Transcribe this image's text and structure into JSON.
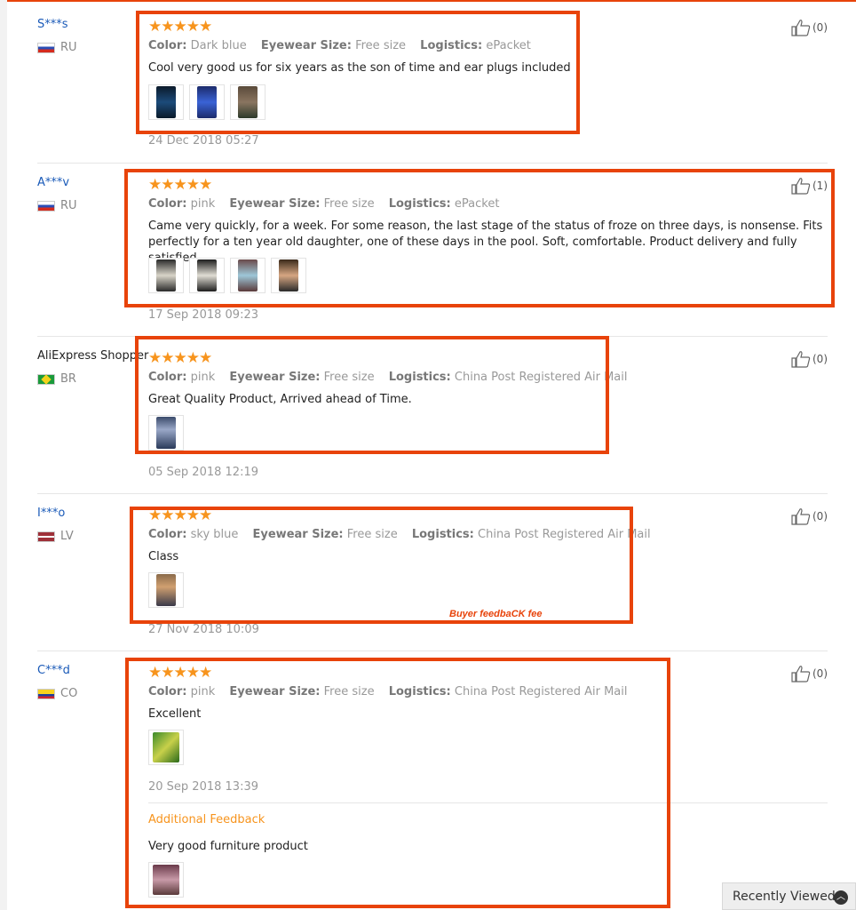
{
  "colors": {
    "accent": "#e8430a",
    "star": "#f7941d",
    "link": "#1a5ab8"
  },
  "labels": {
    "color": "Color:",
    "size": "Eyewear Size:",
    "logistics": "Logistics:",
    "stars": "★★★★★"
  },
  "reviews": [
    {
      "user": "S***s",
      "country": "RU",
      "color": "Dark blue",
      "size": "Free size",
      "logistics": "ePacket",
      "text": "Cool very good us for six years as the son of time and ear plugs included",
      "date": "24 Dec 2018 05:27",
      "helpful": "(0)"
    },
    {
      "user": "A***v",
      "country": "RU",
      "color": "pink",
      "size": "Free size",
      "logistics": "ePacket",
      "text": "Came very quickly, for a week. For some reason, the last stage of the status of froze on three days, is nonsense. Fits perfectly for a ten year old daughter, one of these days in the pool. Soft, comfortable. Product delivery and fully satisfied.",
      "date": "17 Sep 2018 09:23",
      "helpful": "(1)"
    },
    {
      "user": "AliExpress Shopper",
      "country": "BR",
      "color": "pink",
      "size": "Free size",
      "logistics": "China Post Registered Air Mail",
      "text": "Great Quality Product, Arrived ahead of Time.",
      "date": "05 Sep 2018 12:19",
      "helpful": "(0)"
    },
    {
      "user": "I***o",
      "country": "LV",
      "color": "sky blue",
      "size": "Free size",
      "logistics": "China Post Registered Air Mail",
      "text": "Class",
      "date": "27 Nov 2018 10:09",
      "helpful": "(0)"
    },
    {
      "user": "C***d",
      "country": "CO",
      "color": "pink",
      "size": "Free size",
      "logistics": "China Post Registered Air Mail",
      "text": "Excellent",
      "date": "20 Sep 2018 13:39",
      "helpful": "(0)",
      "additional_title": "Additional Feedback",
      "additional_text": "Very good furniture product"
    }
  ],
  "annotation": "Buyer feedbaCK fee",
  "recently_viewed": "Recently Viewed"
}
